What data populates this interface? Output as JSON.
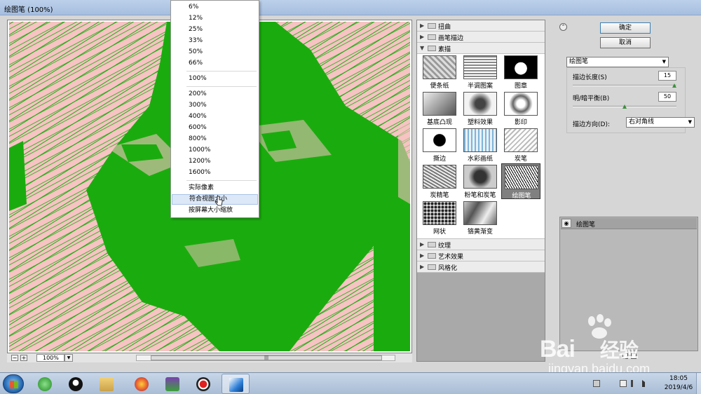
{
  "window": {
    "title": "绘图笔 (100%)"
  },
  "zoom_menu": {
    "items": [
      "6%",
      "12%",
      "25%",
      "33%",
      "50%",
      "66%",
      "100%",
      "200%",
      "300%",
      "400%",
      "600%",
      "800%",
      "1000%",
      "1200%",
      "1600%",
      "实际像素",
      "符合视图大小",
      "按屏幕大小缩放"
    ],
    "highlighted": "符合视图大小"
  },
  "preview": {
    "zoom_value": "100%",
    "minus": "−",
    "plus": "+",
    "colors": {
      "background": "#f7c3c3",
      "stroke": "#1aac0e"
    }
  },
  "gallery": {
    "categories_top": [
      "扭曲",
      "画笔描边",
      "素描"
    ],
    "thumbs": [
      "便条纸",
      "半调图案",
      "图章",
      "基底凸现",
      "塑料效果",
      "影印",
      "撕边",
      "水彩画纸",
      "炭笔",
      "炭精笔",
      "粉笔和炭笔",
      "绘图笔",
      "网状",
      "铬黄渐变"
    ],
    "selected_thumb": "绘图笔",
    "categories_bottom": [
      "纹理",
      "艺术效果",
      "风格化"
    ]
  },
  "settings": {
    "ok": "确定",
    "cancel": "取消",
    "filter_select": "绘图笔",
    "stroke_length_label": "描边长度(S)",
    "stroke_length": "15",
    "stroke_length_level": 0.98,
    "balance_label": "明/暗平衡(B)",
    "balance": "50",
    "balance_level": 0.5,
    "direction_label": "描边方向(D):",
    "direction": "右对角线",
    "layer_name": "绘图笔"
  },
  "taskbar": {
    "time": "18:05",
    "date": "2019/4/6",
    "apps": [
      "windows-explorer-icon",
      "qq-icon",
      "file-manager-icon",
      "firefox-icon",
      "media-player-icon",
      "record-icon",
      "photoshop-feather-icon"
    ]
  },
  "watermark": {
    "brand": "Bai",
    "brand2": "经验",
    "url": "jingyan.baidu.com"
  }
}
